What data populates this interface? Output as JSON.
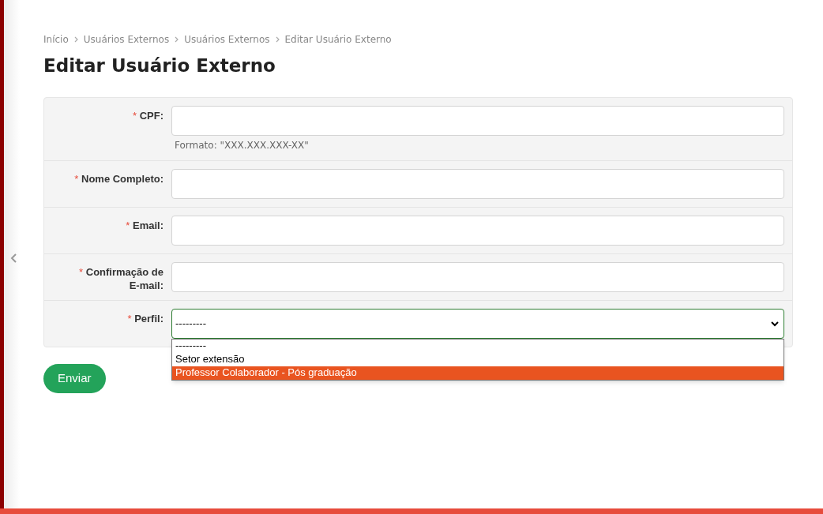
{
  "breadcrumb": [
    "Início",
    "Usuários Externos",
    "Usuários Externos",
    "Editar Usuário Externo"
  ],
  "title": "Editar Usuário Externo",
  "form": {
    "fields": [
      {
        "kind": "text",
        "label": "CPF:",
        "required_mark": "*",
        "help": "Formato: \"XXX.XXX.XXX-XX\""
      },
      {
        "kind": "text",
        "label": "Nome Completo:",
        "required_mark": "*"
      },
      {
        "kind": "text",
        "label": "Email:",
        "required_mark": "*"
      },
      {
        "kind": "text",
        "label": "Confirmação de E-mail:",
        "required_mark": "*"
      },
      {
        "kind": "select",
        "label": "Perfil:",
        "required_mark": "*",
        "value": "---------",
        "open": true,
        "options": [
          {
            "label": "---------",
            "highlighted": false
          },
          {
            "label": "Setor extensão",
            "highlighted": false
          },
          {
            "label": "Professor Colaborador - Pós graduação",
            "highlighted": true
          }
        ]
      }
    ]
  },
  "submit": "Enviar"
}
